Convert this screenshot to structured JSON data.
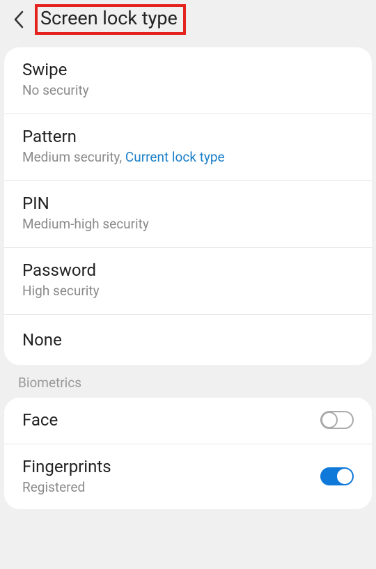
{
  "header": {
    "title": "Screen lock type"
  },
  "lockTypes": [
    {
      "title": "Swipe",
      "sub": "No security",
      "linked": ""
    },
    {
      "title": "Pattern",
      "sub": "Medium security, ",
      "linked": "Current lock type"
    },
    {
      "title": "PIN",
      "sub": "Medium-high security",
      "linked": ""
    },
    {
      "title": "Password",
      "sub": "High security",
      "linked": ""
    },
    {
      "title": "None",
      "sub": "",
      "linked": ""
    }
  ],
  "biometrics": {
    "sectionLabel": "Biometrics",
    "items": [
      {
        "title": "Face",
        "sub": "",
        "enabled": false
      },
      {
        "title": "Fingerprints",
        "sub": "Registered",
        "enabled": true
      }
    ]
  }
}
